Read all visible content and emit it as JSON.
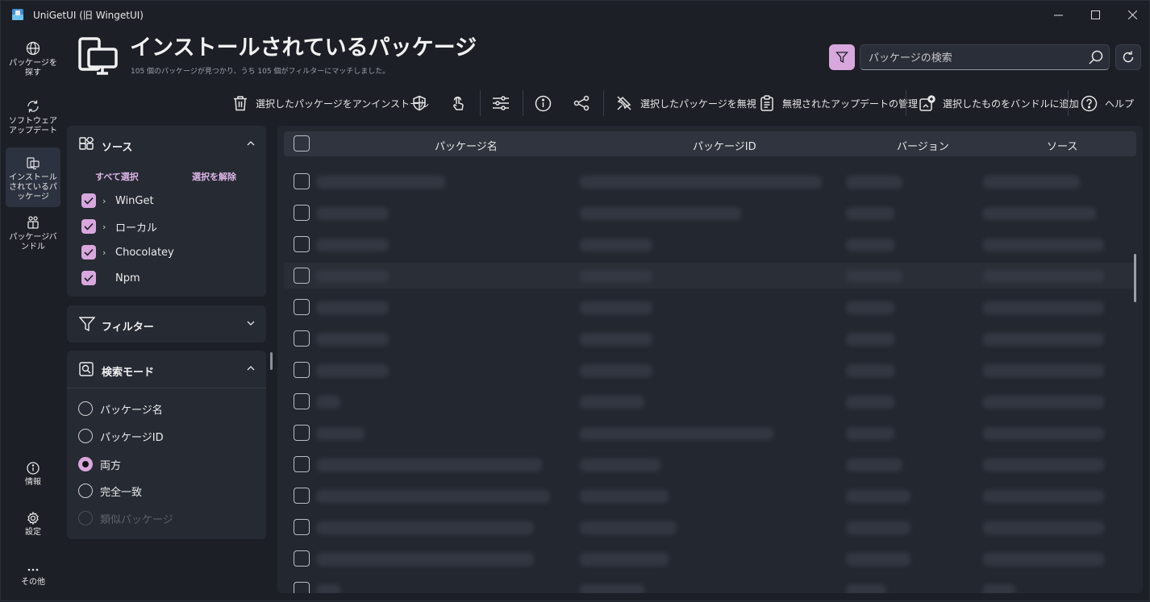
{
  "window": {
    "title": "UniGetUI (旧 WingetUI)",
    "minimize": "—",
    "maximize": "□",
    "close": "✕"
  },
  "nav": [
    {
      "label": "パッケージを探す",
      "icon": "globe-icon"
    },
    {
      "label": "ソフトウェアアップデート",
      "icon": "refresh-icon"
    },
    {
      "label": "インストールされているパッケージ",
      "icon": "installed-icon"
    },
    {
      "label": "パッケージバンドル",
      "icon": "bundle-icon"
    },
    {
      "label": "情報",
      "icon": "info-icon"
    },
    {
      "label": "設定",
      "icon": "gear-icon"
    },
    {
      "label": "その他",
      "icon": "more-icon"
    }
  ],
  "header": {
    "title": "インストールされているパッケージ",
    "subtitle": "105 個のパッケージが見つかり、うち 105 個がフィルターにマッチしました。"
  },
  "search": {
    "placeholder": "パッケージの検索"
  },
  "toolbar": {
    "uninstall": "選択したパッケージをアンインストール",
    "ignore": "選択したパッケージを無視",
    "manage_ignored": "無視されたアップデートの管理",
    "add_bundle": "選択したものをバンドルに追加",
    "help": "ヘルプ"
  },
  "sources": {
    "title": "ソース",
    "select_all": "すべて選択",
    "deselect": "選択を解除",
    "items": [
      "WinGet",
      "ローカル",
      "Chocolatey",
      "Npm"
    ]
  },
  "filters": {
    "title": "フィルター"
  },
  "search_mode": {
    "title": "検索モード",
    "options": [
      "パッケージ名",
      "パッケージID",
      "両方",
      "完全一致",
      "類似パッケージ"
    ],
    "selected": "両方"
  },
  "table": {
    "columns": [
      "パッケージ名",
      "パッケージID",
      "バージョン",
      "ソース"
    ]
  },
  "colors": {
    "accent": "#d8a7dd",
    "background": "#1c1f26",
    "panel": "#262a33"
  }
}
